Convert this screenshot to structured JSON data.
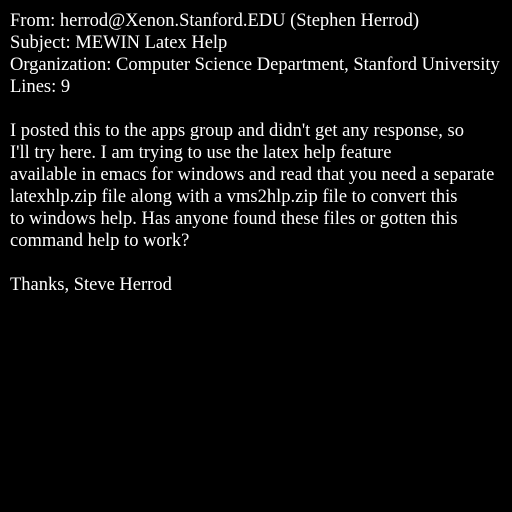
{
  "colors": {
    "background": "#000000",
    "text": "#ffffff"
  },
  "headers": {
    "from": "From: herrod@Xenon.Stanford.EDU (Stephen Herrod)",
    "subject": "Subject: MEWIN Latex Help",
    "organization": "Organization: Computer Science Department, Stanford University",
    "lines": "Lines: 9"
  },
  "body": {
    "lines": [
      "I posted this to the apps group and didn't get any response, so",
      "I'll try here. I am trying to use the latex help feature",
      "available in emacs for windows and read that you need a separate",
      "latexhlp.zip file along with a vms2hlp.zip file to convert this",
      "to windows help. Has anyone found these files or gotten this",
      "command help to work?"
    ],
    "signature": "Thanks, Steve Herrod"
  }
}
